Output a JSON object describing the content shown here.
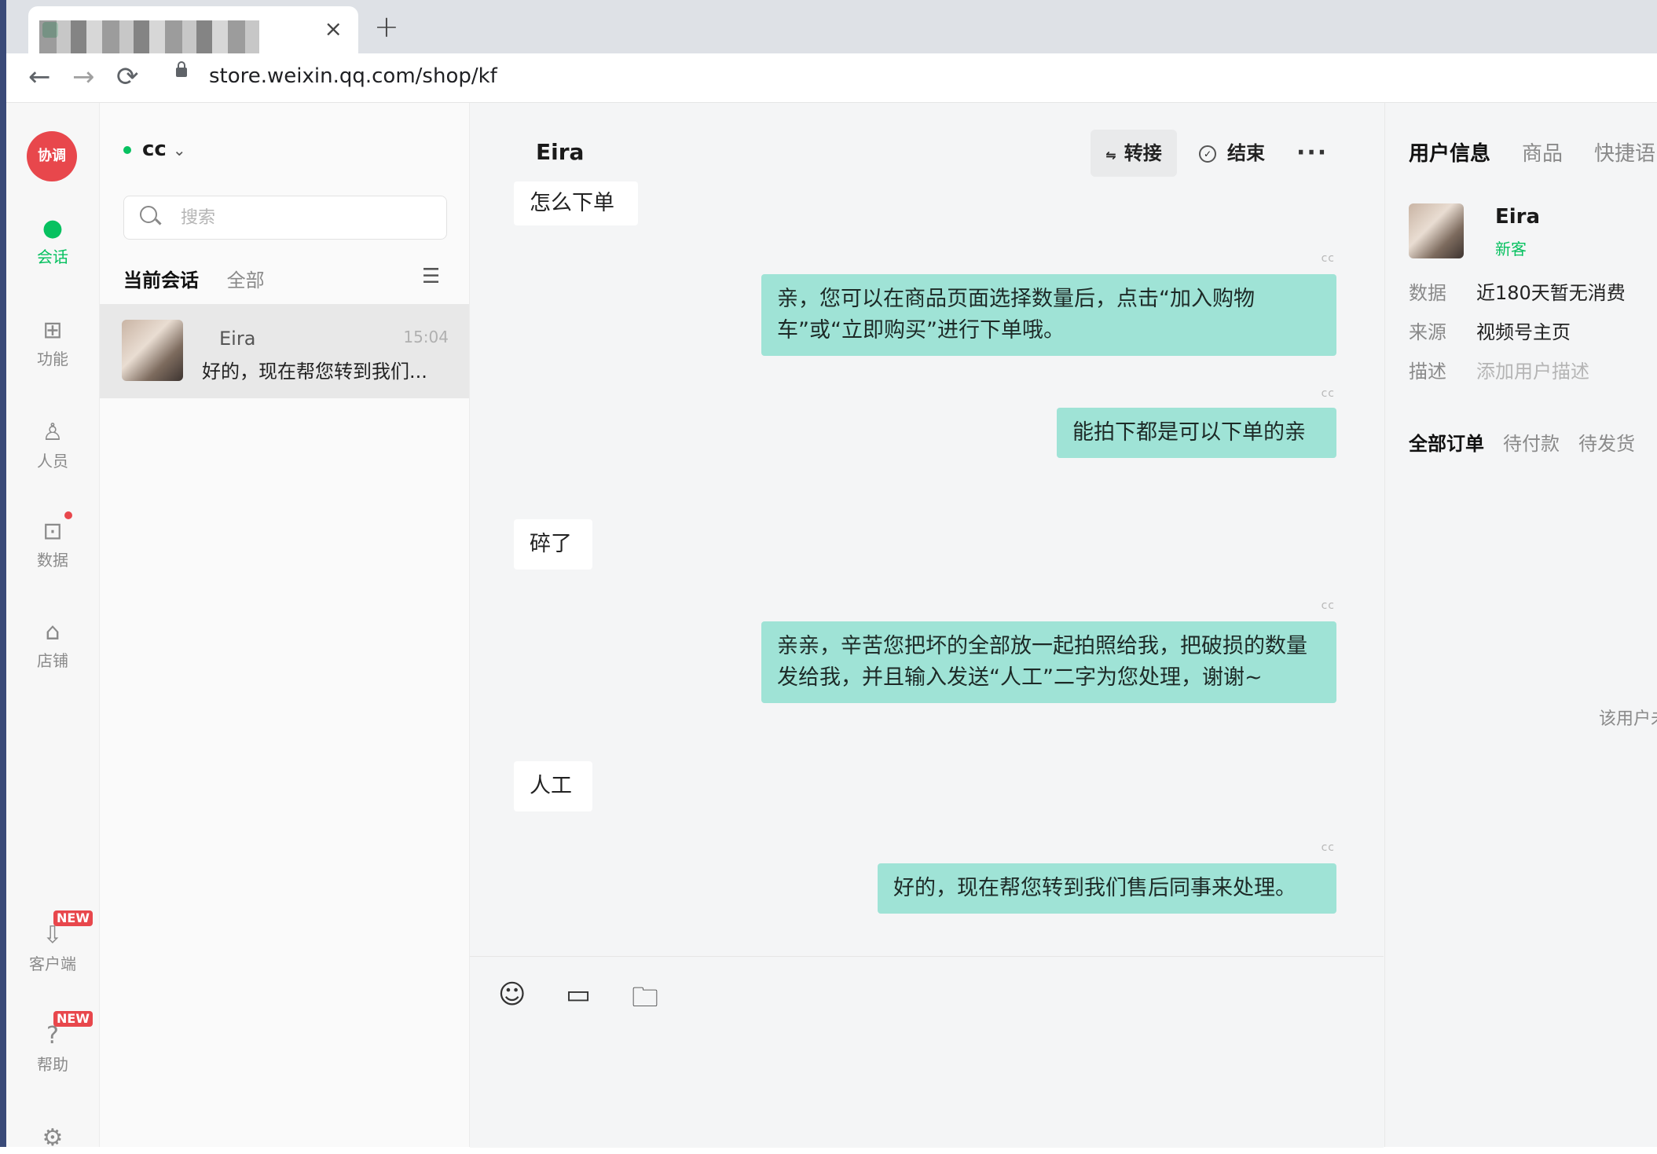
{
  "browser": {
    "tab_close": "×",
    "new_tab": "+",
    "url": "store.weixin.qq.com/shop/kf"
  },
  "rail": {
    "logo_text": "协调",
    "items": [
      {
        "label": "会话",
        "icon": "chat-bubble-icon"
      },
      {
        "label": "功能",
        "icon": "grid-icon"
      },
      {
        "label": "人员",
        "icon": "user-list-icon"
      },
      {
        "label": "数据",
        "icon": "chart-icon"
      },
      {
        "label": "店铺",
        "icon": "store-icon"
      },
      {
        "label": "客户端",
        "icon": "download-icon",
        "badge": "NEW"
      },
      {
        "label": "帮助",
        "icon": "help-icon",
        "badge": "NEW"
      }
    ]
  },
  "conversations": {
    "agent_name": "cc",
    "search_placeholder": "搜索",
    "tabs": [
      "当前会话",
      "全部"
    ],
    "items": [
      {
        "name": "Eira",
        "time": "15:04",
        "preview": "好的，现在帮您转到我们..."
      }
    ]
  },
  "chat": {
    "title": "Eira",
    "transfer_label": "转接",
    "end_label": "结束",
    "more_label": "···",
    "sender_tag": "cc",
    "messages": [
      {
        "dir": "in",
        "text": "怎么下单"
      },
      {
        "dir": "out",
        "text": "亲，您可以在商品页面选择数量后，点击“加入购物车”或“立即购买”进行下单哦。"
      },
      {
        "dir": "out",
        "text": "能拍下都是可以下单的亲"
      },
      {
        "dir": "in",
        "text": "碎了"
      },
      {
        "dir": "out",
        "text": "亲亲，辛苦您把坏的全部放一起拍照给我，把破损的数量发给我，并且输入发送“人工”二字为您处理，谢谢~"
      },
      {
        "dir": "in",
        "text": "人工"
      },
      {
        "dir": "out",
        "text": "好的，现在帮您转到我们售后同事来处理。"
      }
    ],
    "tools": [
      "emoji-icon",
      "image-icon",
      "folder-icon"
    ]
  },
  "info": {
    "tabs": [
      "用户信息",
      "商品",
      "快捷语"
    ],
    "user_name": "Eira",
    "user_tag": "新客",
    "fields": [
      {
        "key": "数据",
        "value": "近180天暂无消费"
      },
      {
        "key": "来源",
        "value": "视频号主页"
      },
      {
        "key": "描述",
        "value": "添加用户描述"
      }
    ],
    "order_tabs": [
      "全部订单",
      "待付款",
      "待发货"
    ],
    "empty_text": "该用户未"
  }
}
